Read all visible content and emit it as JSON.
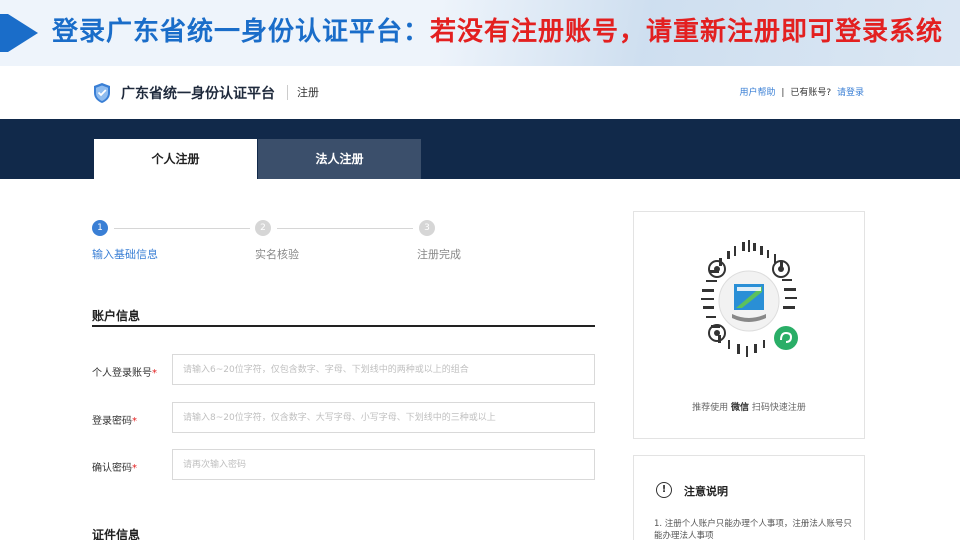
{
  "banner": {
    "title_blue": "登录广东省统一身份认证平台：",
    "title_red": "若没有注册账号，请重新注册即可登录系统"
  },
  "header": {
    "site_title": "广东省统一身份认证平台",
    "section": "注册",
    "help_link": "用户帮助",
    "separator": "|",
    "have_account": "已有账号?",
    "login_link": "请登录"
  },
  "tabs": [
    {
      "label": "个人注册",
      "active": true
    },
    {
      "label": "法人注册",
      "active": false
    }
  ],
  "steps": [
    {
      "number": "1",
      "label": "输入基础信息",
      "active": true
    },
    {
      "number": "2",
      "label": "实名核验",
      "active": false
    },
    {
      "number": "3",
      "label": "注册完成",
      "active": false
    }
  ],
  "account_section": {
    "title": "账户信息",
    "fields": [
      {
        "label": "个人登录账号",
        "required_mark": "*",
        "placeholder": "请输入6~20位字符，仅包含数字、字母、下划线中的两种或以上的组合",
        "value": ""
      },
      {
        "label": "登录密码",
        "required_mark": "*",
        "placeholder": "请输入8~20位字符，仅含数字、大写字母、小写字母、下划线中的三种或以上",
        "value": ""
      },
      {
        "label": "确认密码",
        "required_mark": "*",
        "placeholder": "请再次输入密码",
        "value": ""
      }
    ]
  },
  "id_section": {
    "title": "证件信息"
  },
  "qr": {
    "caption_prefix": "推荐使用 ",
    "caption_bold": "微信",
    "caption_suffix": " 扫码快速注册"
  },
  "notice": {
    "icon": "!",
    "title": "注意说明",
    "text": "1. 注册个人账户只能办理个人事项，注册法人账号只能办理法人事项"
  },
  "colors": {
    "accent": "#1a6dc9",
    "warning": "#e32020",
    "nav_dark": "#11294a",
    "link": "#3a7fd5"
  }
}
